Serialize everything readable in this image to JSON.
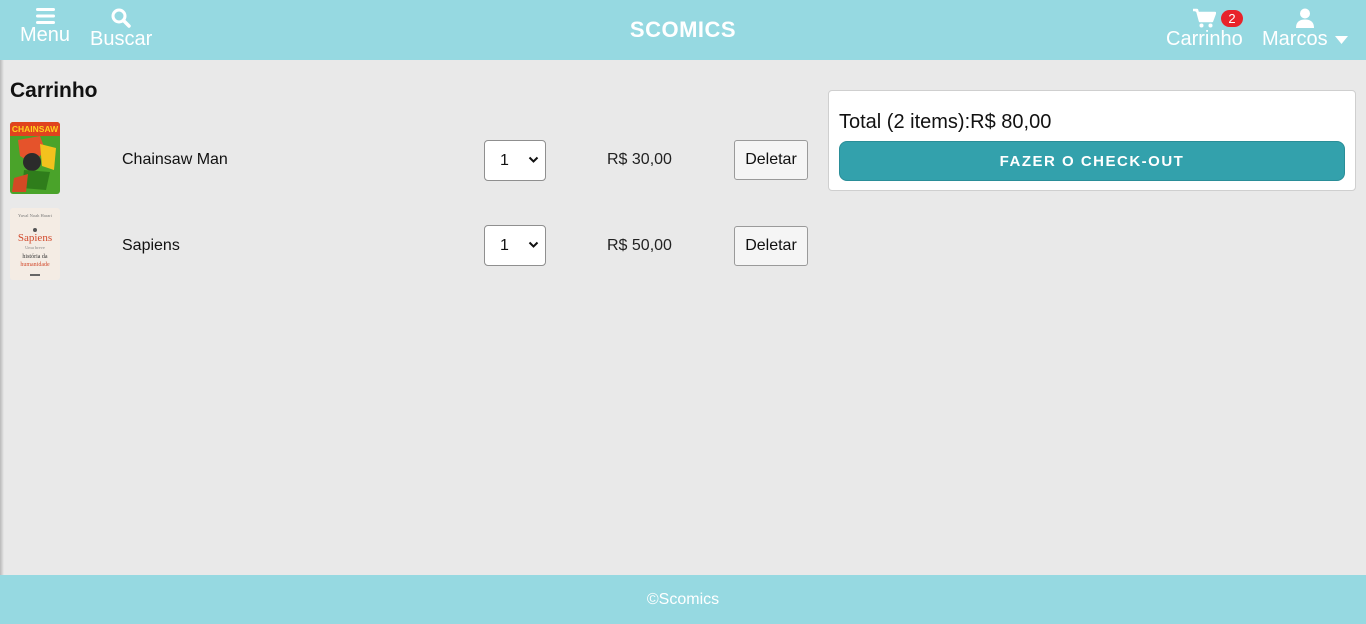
{
  "header": {
    "menu_label": "Menu",
    "search_label": "Buscar",
    "brand": "SCOMICS",
    "cart_label": "Carrinho",
    "cart_count": "2",
    "user_label": "Marcos",
    "bar_color": "#96d9e1",
    "badge_color": "#e8232a"
  },
  "cart": {
    "title": "Carrinho",
    "delete_label": "Deletar",
    "items": [
      {
        "name": "Chainsaw Man",
        "quantity": "1",
        "price": "R$ 30,00",
        "cover_text": "CHAINSAW"
      },
      {
        "name": "Sapiens",
        "quantity": "1",
        "price": "R$ 50,00",
        "cover_author": "Yuval Noah Harari",
        "cover_title": "Sapiens",
        "cover_subtitle": "Uma breve",
        "cover_line1": "história da",
        "cover_line2": "humanidade"
      }
    ]
  },
  "summary": {
    "total_text": "Total (2 items):R$ 80,00",
    "checkout_label": "FAZER O CHECK-OUT",
    "checkout_color": "#33a1ac"
  },
  "footer": {
    "text": "©Scomics"
  },
  "icons": [
    "menu-icon",
    "search-icon",
    "cart-icon",
    "user-icon",
    "caret-down-icon",
    "chevron-down-icon"
  ]
}
